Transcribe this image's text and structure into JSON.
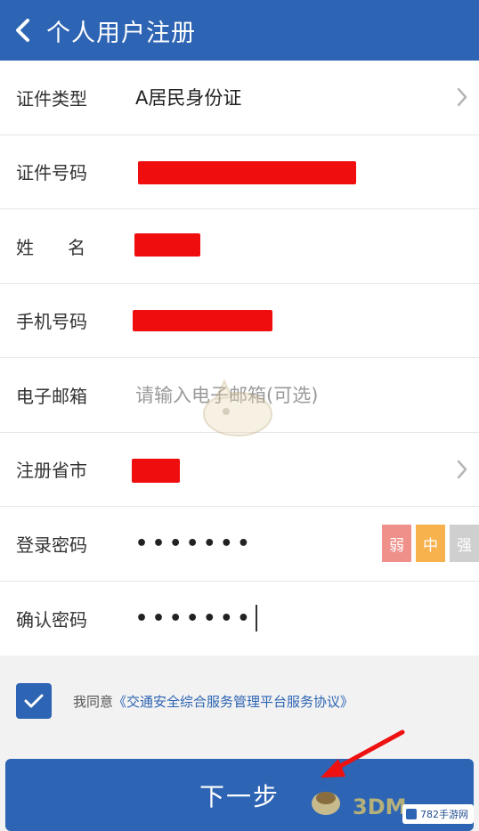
{
  "header": {
    "title": "个人用户注册"
  },
  "form": {
    "id_type": {
      "label": "证件类型",
      "value": "A居民身份证"
    },
    "id_number": {
      "label": "证件号码"
    },
    "name": {
      "label": "姓      名"
    },
    "phone": {
      "label": "手机号码"
    },
    "email": {
      "label": "电子邮箱",
      "placeholder": "请输入电子邮箱(可选)"
    },
    "region": {
      "label": "注册省市"
    },
    "password": {
      "label": "登录密码",
      "value": "•••••••"
    },
    "confirm": {
      "label": "确认密码",
      "value": "•••••••"
    },
    "strength": {
      "weak": "弱",
      "medium": "中",
      "strong": "强"
    }
  },
  "agreement": {
    "prefix": "我同意",
    "link": "《交通安全综合服务管理平台服务协议》"
  },
  "next_button": {
    "label": "下一步"
  },
  "watermark": {
    "site": "3DM",
    "badge": "782手游网"
  },
  "colors": {
    "primary": "#2d64b3",
    "redaction": "#ef0d0d",
    "weak": "#f0908b",
    "medium": "#f7b14d",
    "strong": "#cfcfcf"
  }
}
